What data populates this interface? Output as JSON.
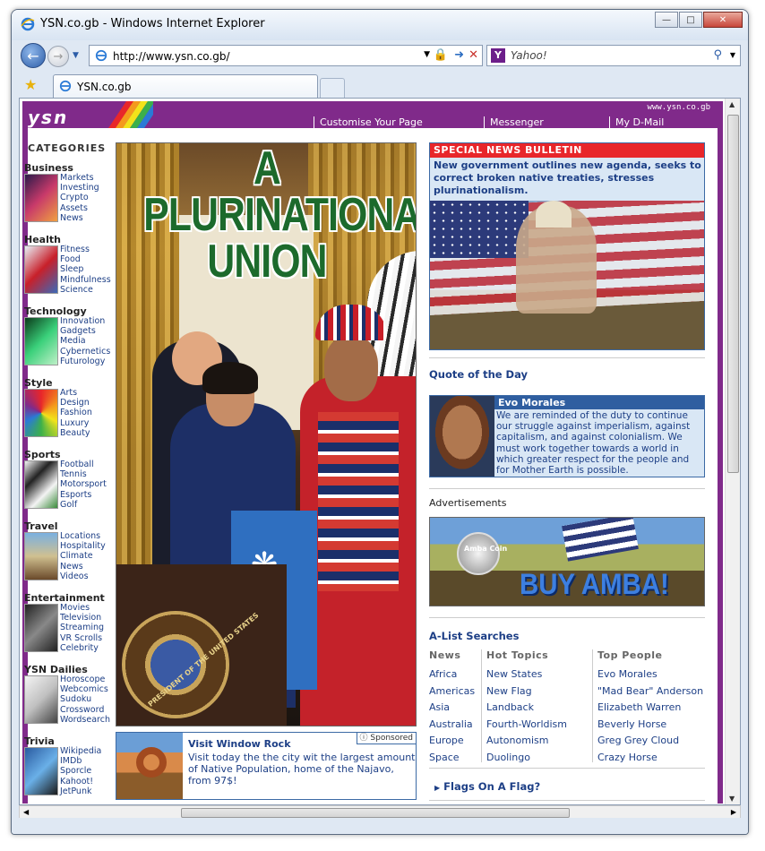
{
  "window": {
    "title": "YSN.co.gb - Windows Internet Explorer",
    "url": "http://www.ysn.co.gb/",
    "search_placeholder": "Yahoo!",
    "tab_title": "YSN.co.gb"
  },
  "site": {
    "logo": "ysn",
    "site_url": "www.ysn.co.gb",
    "nav": [
      "Customise Your Page",
      "Messenger",
      "My D-Mail"
    ]
  },
  "categories": {
    "title": "CATEGORIES",
    "groups": [
      {
        "name": "Business",
        "links": [
          "Markets",
          "Investing",
          "Crypto",
          "Assets",
          "News"
        ]
      },
      {
        "name": "Health",
        "links": [
          "Fitness",
          "Food",
          "Sleep",
          "Mindfulness",
          "Science"
        ]
      },
      {
        "name": "Technology",
        "links": [
          "Innovation",
          "Gadgets",
          "Media",
          "Cybernetics",
          "Futurology"
        ]
      },
      {
        "name": "Style",
        "links": [
          "Arts",
          "Design",
          "Fashion",
          "Luxury",
          "Beauty"
        ]
      },
      {
        "name": "Sports",
        "links": [
          "Football",
          "Tennis",
          "Motorsport",
          "Esports",
          "Golf"
        ]
      },
      {
        "name": "Travel",
        "links": [
          "Locations",
          "Hospitality",
          "Climate",
          "News",
          "Videos"
        ]
      },
      {
        "name": "Entertainment",
        "links": [
          "Movies",
          "Television",
          "Streaming",
          "VR Scrolls",
          "Celebrity"
        ]
      },
      {
        "name": "YSN Dailies",
        "links": [
          "Horoscope",
          "Webcomics",
          "Sudoku",
          "Crossword",
          "Wordsearch"
        ]
      },
      {
        "name": "Trivia",
        "links": [
          "Wikipedia",
          "IMDb",
          "Sporcle",
          "Kahoot!",
          "JetPunk"
        ]
      }
    ]
  },
  "hero": {
    "title": "A PLURINATIONAL UNION",
    "seal_text": "PRESIDENT OF THE UNITED STATES"
  },
  "sponsored": {
    "badge": "ⓘ Sponsored",
    "title": "Visit Window Rock",
    "body": "Visit today the the city wit the largest amount of Native Population, home of the Najavo, from 97$!"
  },
  "bulletin": {
    "heading": "SPECIAL NEWS BULLETIN",
    "text": "New government outlines new agenda, seeks to correct broken native treaties, stresses plurinationalism."
  },
  "quote": {
    "section_title": "Quote of the Day",
    "person": "Evo Morales",
    "text": "We are reminded of the duty to continue our struggle against imperialism, against capitalism, and against colonialism. We must work together towards a world in which greater respect for the people and for Mother Earth is possible."
  },
  "ads": {
    "label": "Advertisements",
    "coin_text": "Amba Coin",
    "banner_text": "BUY AMBA!"
  },
  "alist": {
    "title": "A-List Searches",
    "columns": [
      {
        "head": "News",
        "items": [
          "Africa",
          "Americas",
          "Asia",
          "Australia",
          "Europe",
          "Space"
        ]
      },
      {
        "head": "Hot Topics",
        "items": [
          "New States",
          "New Flag",
          "Landback",
          "Fourth-Worldism",
          "Autonomism",
          "Duolingo"
        ]
      },
      {
        "head": "Top People",
        "items": [
          "Evo Morales",
          "\"Mad Bear\" Anderson",
          "Elizabeth Warren",
          "Beverly Horse",
          "Greg Grey Cloud",
          "Crazy Horse"
        ]
      }
    ]
  },
  "flags_link": "Flags On A Flag?"
}
